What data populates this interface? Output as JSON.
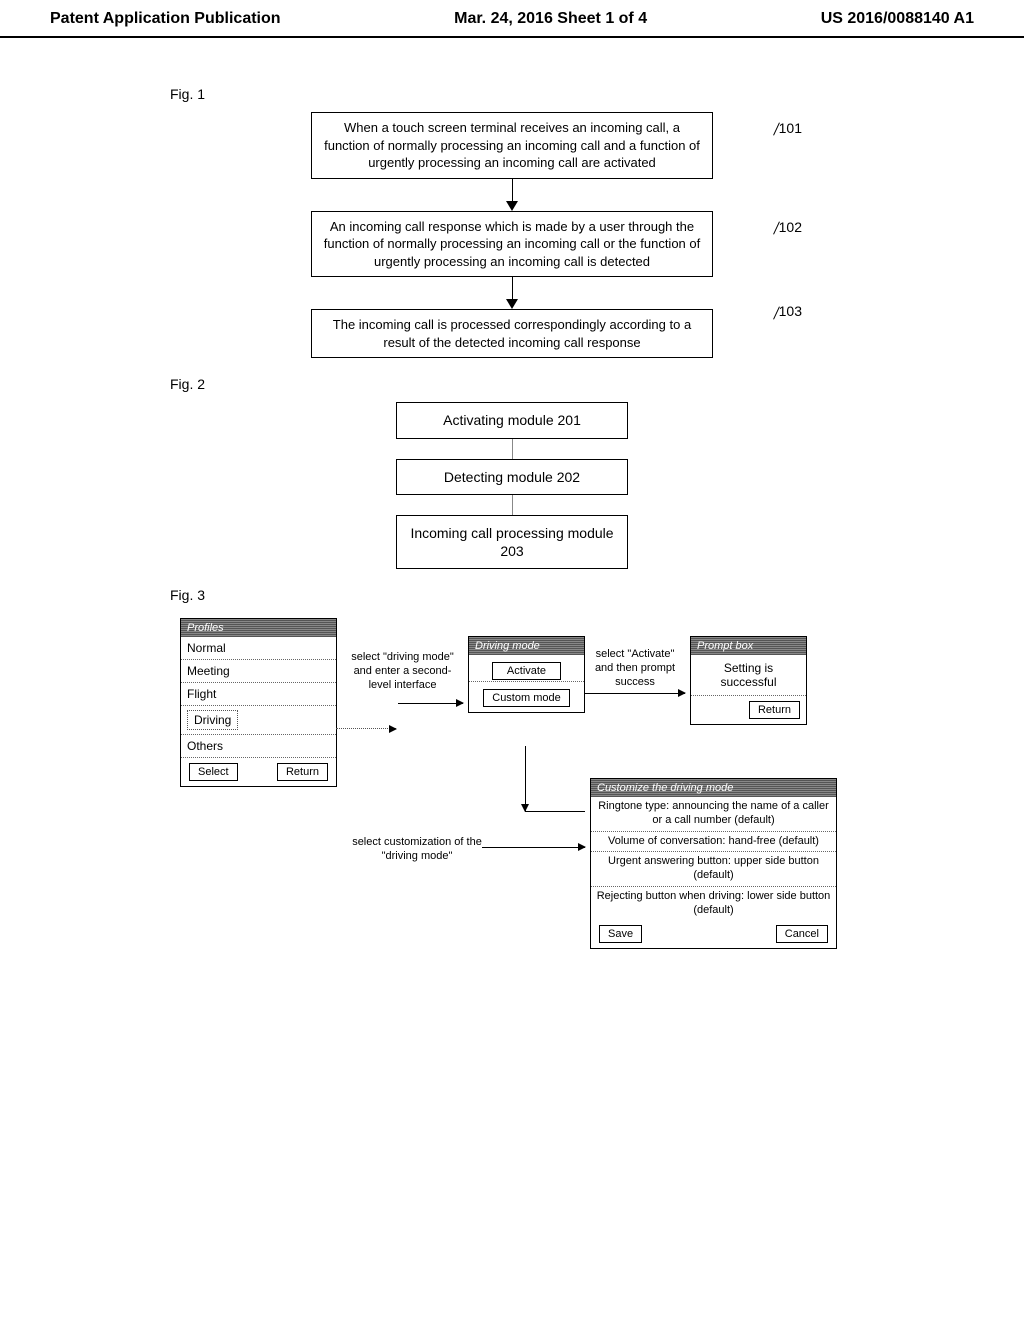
{
  "header": {
    "left": "Patent Application Publication",
    "center": "Mar. 24, 2016  Sheet 1 of 4",
    "right": "US 2016/0088140 A1"
  },
  "fig1": {
    "label": "Fig. 1",
    "step1": "When a touch screen terminal receives an incoming call, a function of normally processing an incoming call and a function of urgently processing an incoming call are activated",
    "step1_num": "101",
    "step2": "An incoming call response which is made by a user through the function of normally processing an incoming call or the function of urgently processing an incoming call is detected",
    "step2_num": "102",
    "step3": "The incoming call is processed correspondingly according to a result of the detected incoming call response",
    "step3_num": "103"
  },
  "fig2": {
    "label": "Fig. 2",
    "mod1": "Activating module 201",
    "mod2": "Detecting module 202",
    "mod3": "Incoming call processing module 203"
  },
  "fig3": {
    "label": "Fig. 3",
    "profiles_header": "Profiles",
    "profiles": [
      "Normal",
      "Meeting",
      "Flight",
      "Driving",
      "Others"
    ],
    "select_btn": "Select",
    "return_btn": "Return",
    "arrow1_text": "select \"driving mode\" and enter a second-level interface",
    "panel2_header": "Driving mode",
    "panel2_btn1": "Activate",
    "panel2_btn2": "Custom mode",
    "arrow2_text": "select \"Activate\" and then prompt success",
    "panel3_header": "Prompt box",
    "panel3_text": "Setting is successful",
    "arrow3_text": "select customization of the \"driving mode\"",
    "panel4_header": "Customize the driving mode",
    "panel4_items": [
      "Ringtone type: announcing the name of a caller or a call number (default)",
      "Volume of conversation: hand-free (default)",
      "Urgent answering button: upper side button (default)",
      "Rejecting button when driving: lower side button (default)"
    ],
    "save_btn": "Save",
    "cancel_btn": "Cancel"
  }
}
